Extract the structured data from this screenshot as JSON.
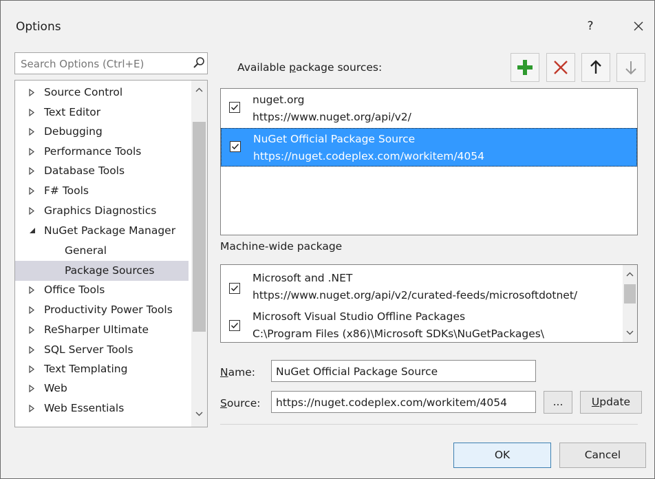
{
  "window": {
    "title": "Options",
    "help_label": "?",
    "close_label": "✕"
  },
  "search": {
    "placeholder": "Search Options (Ctrl+E)"
  },
  "tree": {
    "items": [
      {
        "label": "Source Control"
      },
      {
        "label": "Text Editor"
      },
      {
        "label": "Debugging"
      },
      {
        "label": "Performance Tools"
      },
      {
        "label": "Database Tools"
      },
      {
        "label": "F# Tools"
      },
      {
        "label": "Graphics Diagnostics"
      },
      {
        "label": "NuGet Package Manager"
      },
      {
        "label": "General"
      },
      {
        "label": "Package Sources"
      },
      {
        "label": "Office Tools"
      },
      {
        "label": "Productivity Power Tools"
      },
      {
        "label": "ReSharper Ultimate"
      },
      {
        "label": "SQL Server Tools"
      },
      {
        "label": "Text Templating"
      },
      {
        "label": "Web"
      },
      {
        "label": "Web Essentials"
      }
    ],
    "selected": "Package Sources"
  },
  "available": {
    "label_pre": "Available ",
    "label_accel": "p",
    "label_post": "ackage sources:",
    "sources": [
      {
        "name": "nuget.org",
        "url": "https://www.nuget.org/api/v2/",
        "checked": true
      },
      {
        "name": "NuGet Official Package Source",
        "url": "https://nuget.codeplex.com/workitem/4054",
        "checked": true
      }
    ]
  },
  "machine": {
    "label": "Machine-wide package",
    "sources": [
      {
        "name": "Microsoft and .NET",
        "url": "https://www.nuget.org/api/v2/curated-feeds/microsoftdotnet/",
        "checked": true
      },
      {
        "name": "Microsoft Visual Studio Offline Packages",
        "url": "C:\\Program Files (x86)\\Microsoft SDKs\\NuGetPackages\\",
        "checked": true
      }
    ]
  },
  "form": {
    "name_label_accel": "N",
    "name_label_rest": "ame:",
    "name_value": "NuGet Official Package Source",
    "source_label_accel": "S",
    "source_label_rest": "ource:",
    "source_value": "https://nuget.codeplex.com/workitem/4054",
    "browse_label": "...",
    "update_accel": "U",
    "update_rest": "pdate"
  },
  "footer": {
    "ok_label": "OK",
    "cancel_label": "Cancel"
  },
  "colors": {
    "selection": "#3399ff",
    "add_green": "#2e9a2e",
    "remove_red": "#c0392b"
  }
}
